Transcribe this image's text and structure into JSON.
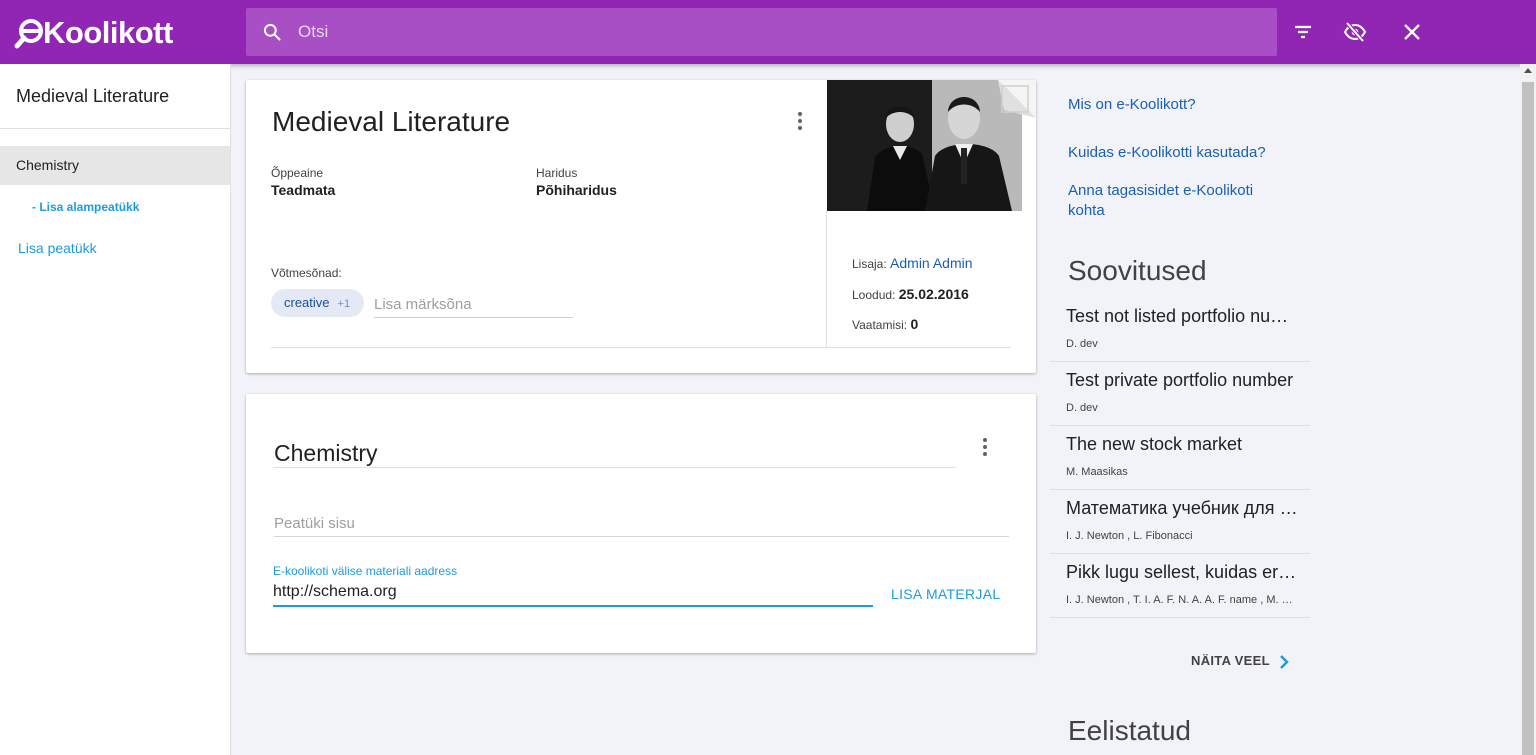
{
  "app": {
    "logo_e": "e",
    "logo_text": "Koolikott",
    "search_placeholder": "Otsi"
  },
  "topbar_icons": [
    "search-icon",
    "filter-icon",
    "visibility-off-icon",
    "close-icon"
  ],
  "sidebar": {
    "title": "Medieval Literature",
    "active_item": "Chemistry",
    "sub_item": "- Lisa alampeatükk",
    "add_chapter": "Lisa peatükk"
  },
  "portfolio": {
    "title": "Medieval Literature",
    "subject_label": "Õppeaine",
    "subject_value": "Teadmata",
    "education_label": "Haridus",
    "education_value": "Põhiharidus",
    "keywords_label": "Võtmesõnad:",
    "keyword_chip": "creative",
    "keyword_more": "+1",
    "keyword_placeholder": "Lisa märksõna",
    "creator_label": "Lisaja:",
    "creator_name": "Admin Admin",
    "created_label": "Loodud:",
    "created_date": "25.02.2016",
    "views_label": "Vaatamisi:",
    "views_count": "0"
  },
  "chapter": {
    "title": "Chemistry",
    "content_placeholder": "Peatüki sisu",
    "url_label": "E-koolikoti välise materiali aadress",
    "url_value": "http://schema.org",
    "add_material": "LISA MATERJAL"
  },
  "right": {
    "links": [
      "Mis on e-Koolikott?",
      "Kuidas e-Koolikotti kasutada?",
      "Anna tagasisidet e-Koolikoti kohta"
    ],
    "recommendations_title": "Soovitused",
    "recommendations": [
      {
        "title": "Test not listed portfolio number",
        "authors": "D. dev"
      },
      {
        "title": "Test private portfolio number",
        "authors": "D. dev"
      },
      {
        "title": "The new stock market",
        "authors": "M. Maasikas"
      },
      {
        "title": "Математика учебник для школьников",
        "authors": "I. J. Newton , L. Fibonacci"
      },
      {
        "title": "Pikk lugu sellest, kuidas erinevad",
        "authors": "I. J. Newton , T. I. A. F. N. A. A. F. name , M. Maasikas"
      }
    ],
    "show_more": "NÄITA VEEL",
    "featured_title": "Eelistatud"
  }
}
